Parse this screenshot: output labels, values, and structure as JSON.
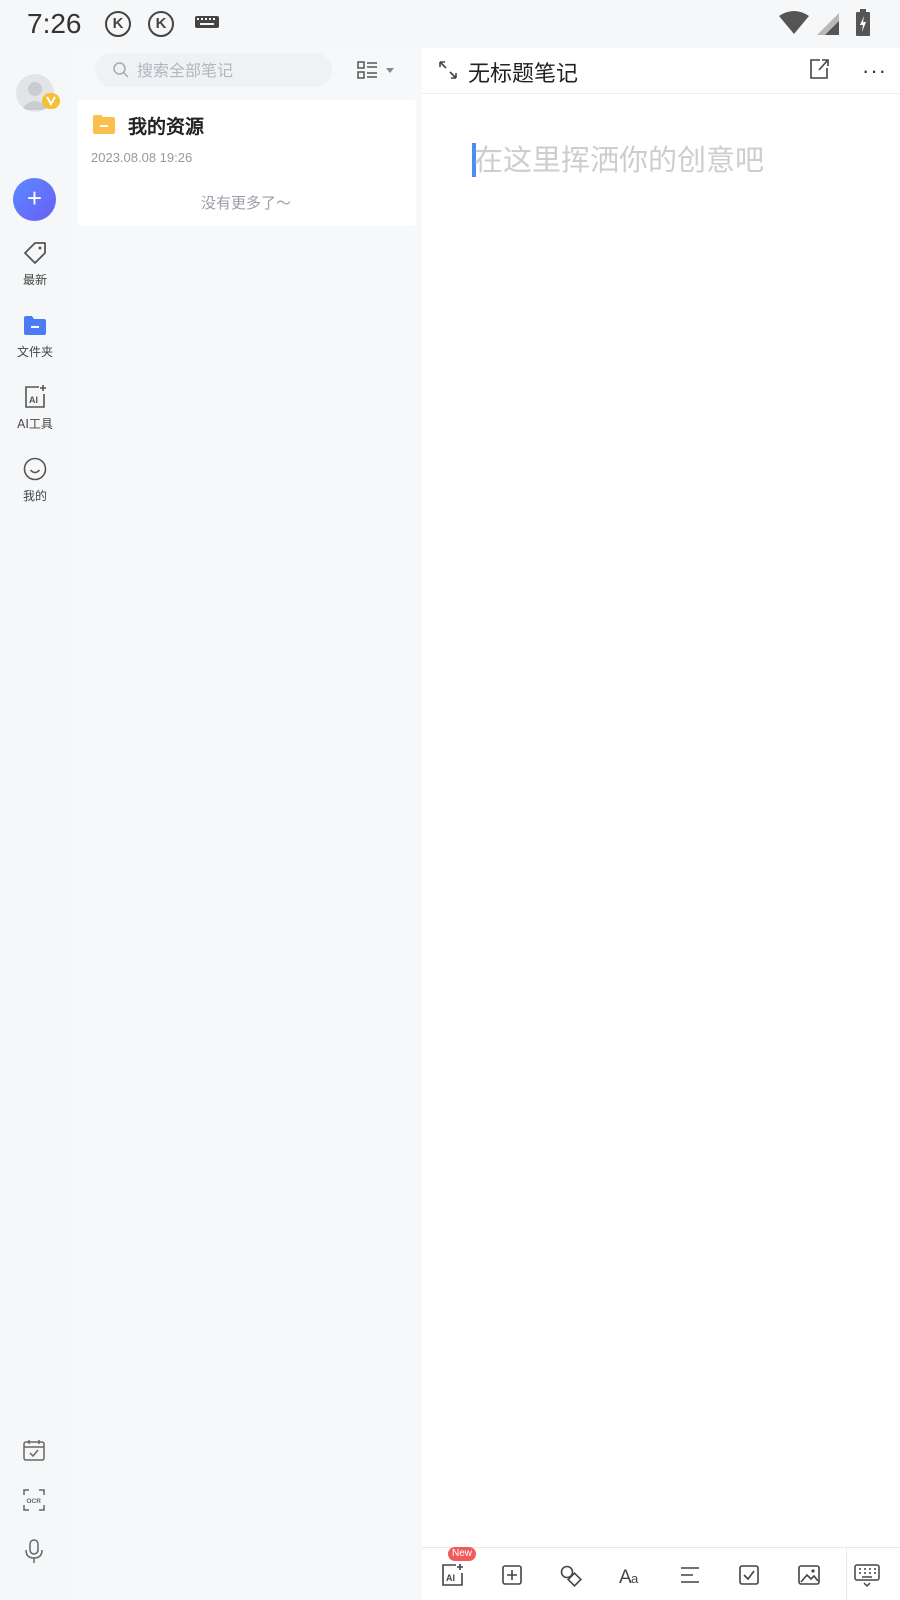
{
  "status_bar": {
    "time": "7:26",
    "notification_1": "K",
    "notification_2": "K"
  },
  "rail": {
    "items": [
      {
        "label": "最新",
        "icon": "tag-icon"
      },
      {
        "label": "文件夹",
        "icon": "folder-icon"
      },
      {
        "label": "AI工具",
        "icon": "ai-tool-icon"
      },
      {
        "label": "我的",
        "icon": "smile-icon"
      }
    ],
    "create_label": "+",
    "accent": "#5a7ef8"
  },
  "search": {
    "placeholder": "搜索全部笔记"
  },
  "list": {
    "items": [
      {
        "title": "我的资源",
        "date": "2023.08.08 19:26"
      }
    ],
    "footer": "没有更多了～"
  },
  "editor": {
    "title": "无标题笔记",
    "placeholder": "在这里挥洒你的创意吧",
    "more_label": "···"
  },
  "toolbar": {
    "new_badge": "New"
  }
}
